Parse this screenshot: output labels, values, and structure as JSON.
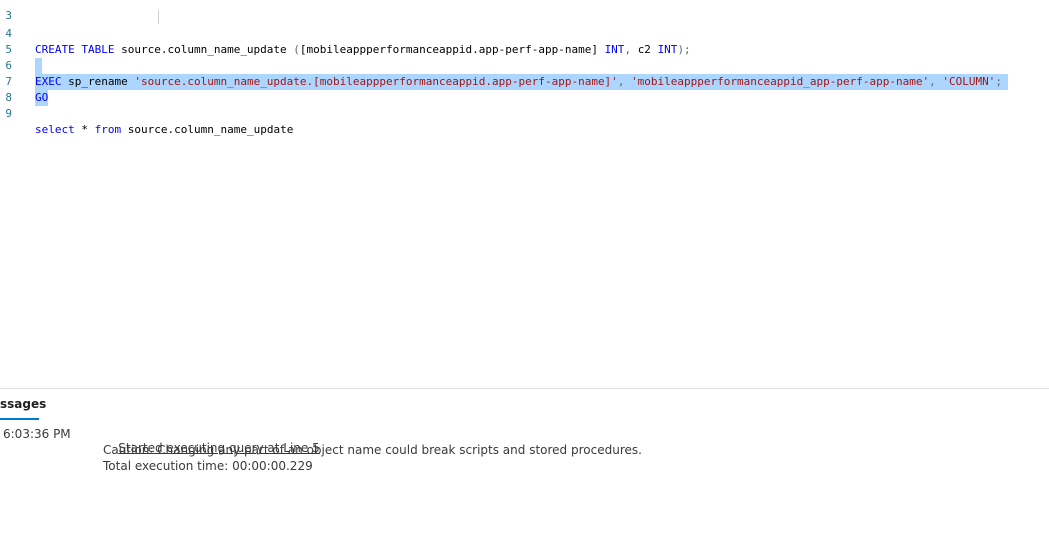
{
  "editor": {
    "lines": [
      {
        "num": "3",
        "segments": []
      },
      {
        "num": "4",
        "segments": [
          {
            "cls": "kw",
            "text": "CREATE TABLE"
          },
          {
            "cls": "",
            "text": " source.column_name_update "
          },
          {
            "cls": "gray",
            "text": "("
          },
          {
            "cls": "",
            "text": "[mobileappperformanceappid.app-perf-app-name] "
          },
          {
            "cls": "kw",
            "text": "INT"
          },
          {
            "cls": "gray",
            "text": ", "
          },
          {
            "cls": "",
            "text": "c2 "
          },
          {
            "cls": "kw",
            "text": "INT"
          },
          {
            "cls": "gray",
            "text": ");"
          }
        ]
      },
      {
        "num": "5",
        "segments": []
      },
      {
        "num": "6",
        "segments": [
          {
            "cls": "kw",
            "text": "EXEC"
          },
          {
            "cls": "",
            "text": " sp_rename "
          },
          {
            "cls": "str",
            "text": "'source.column_name_update.[mobileappperformanceappid.app-perf-app-name]'"
          },
          {
            "cls": "gray",
            "text": ", "
          },
          {
            "cls": "str",
            "text": "'mobileappperformanceappid_app-perf-app-name'"
          },
          {
            "cls": "gray",
            "text": ", "
          },
          {
            "cls": "str",
            "text": "'COLUMN'"
          },
          {
            "cls": "gray",
            "text": ";"
          }
        ]
      },
      {
        "num": "7",
        "segments": [
          {
            "cls": "kw",
            "text": "GO"
          }
        ]
      },
      {
        "num": "8",
        "segments": []
      },
      {
        "num": "9",
        "segments": [
          {
            "cls": "kw",
            "text": "select"
          },
          {
            "cls": "",
            "text": " * "
          },
          {
            "cls": "kw",
            "text": "from"
          },
          {
            "cls": "",
            "text": " source.column_name_update"
          }
        ]
      }
    ]
  },
  "messages": {
    "tab_label": "ssages",
    "timestamp": "6:03:36 PM",
    "link_text": "Started executing query at Line 5",
    "caution": "Caution: Changing any part of an object name could break scripts and stored procedures.",
    "total_time": "Total execution time: 00:00:00.229"
  }
}
